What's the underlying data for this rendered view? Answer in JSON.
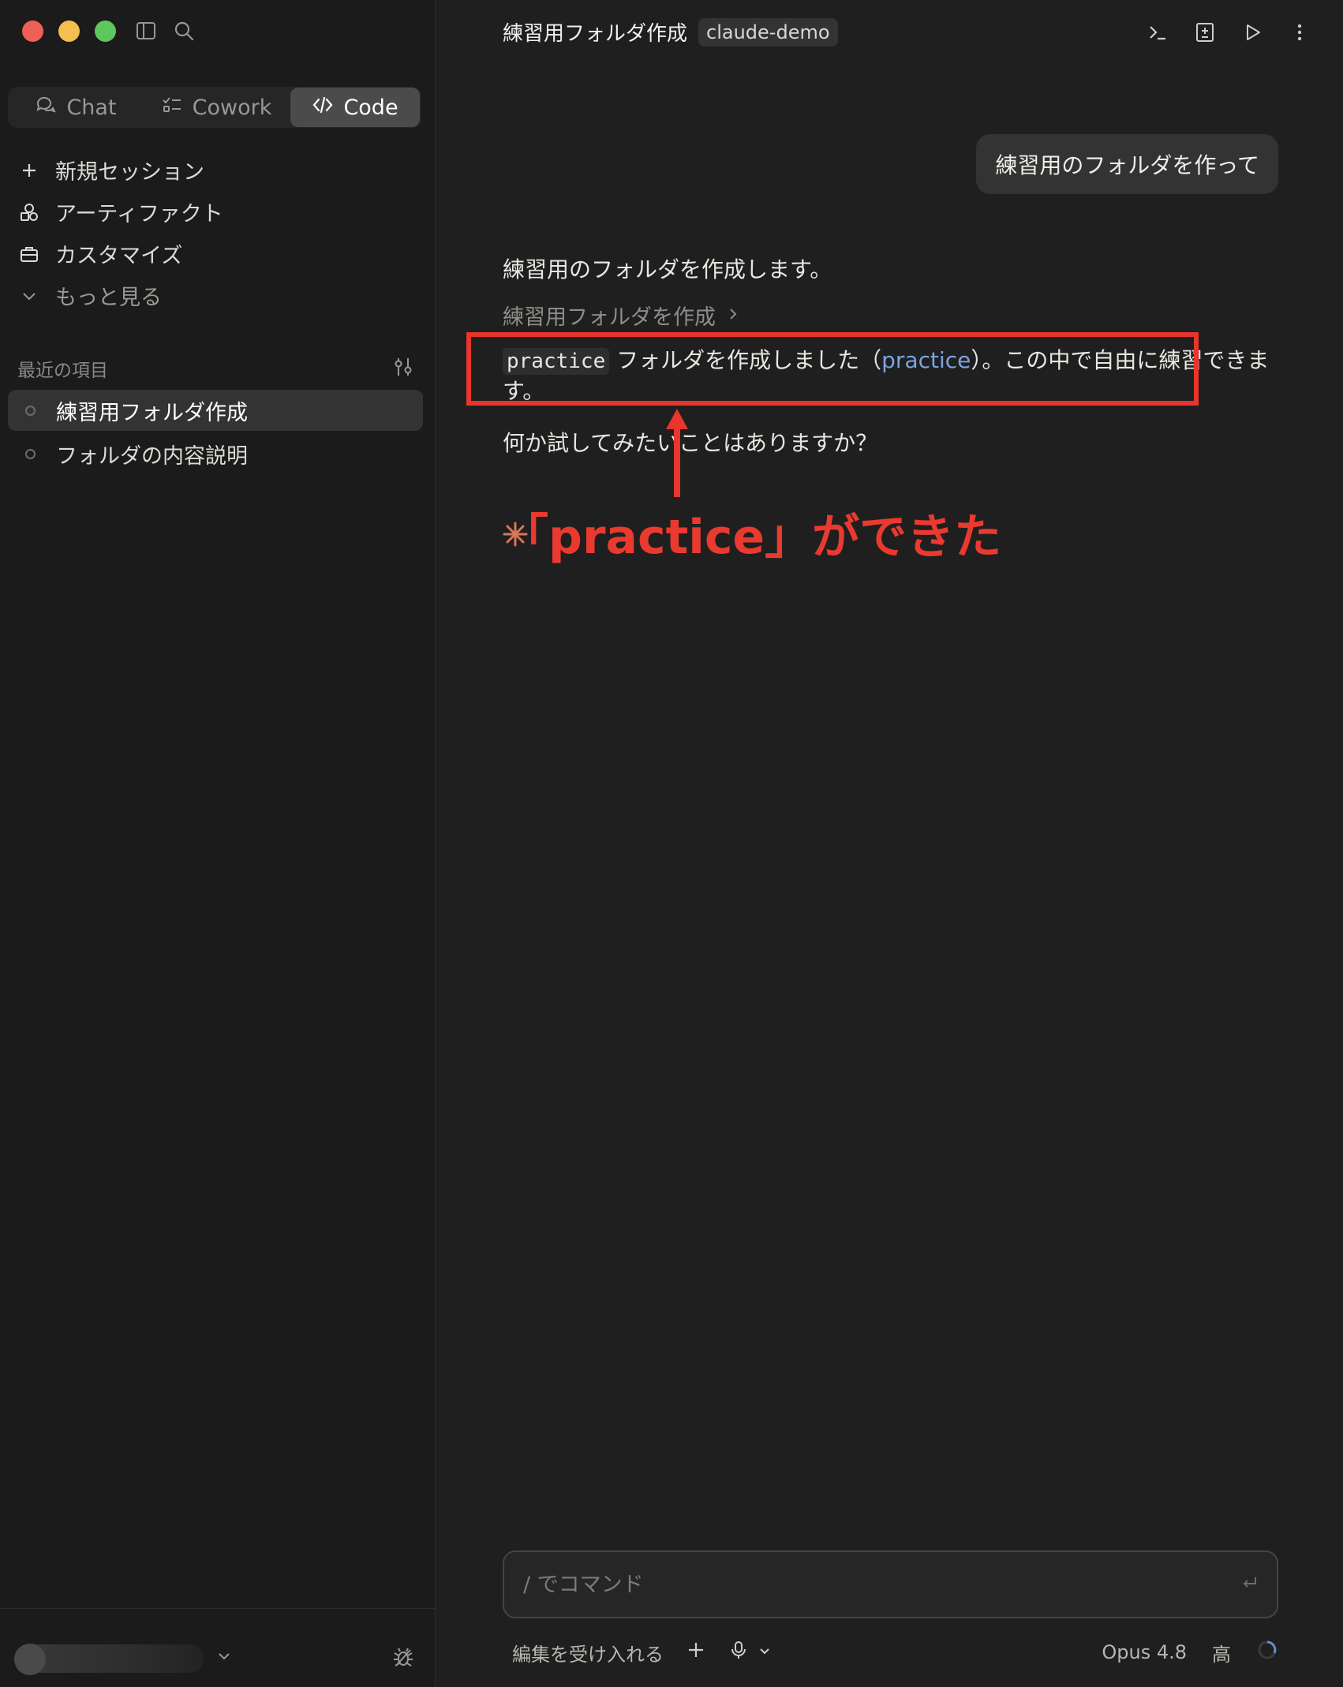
{
  "sidebar": {
    "modes": [
      {
        "label": "Chat",
        "icon": "chat-bubbles-icon"
      },
      {
        "label": "Cowork",
        "icon": "checklist-icon"
      },
      {
        "label": "Code",
        "icon": "code-brackets-icon"
      }
    ],
    "nav": {
      "new_session": "新規セッション",
      "artifacts": "アーティファクト",
      "customize": "カスタマイズ",
      "more": "もっと見る"
    },
    "recent_label": "最近の項目",
    "recent_items": [
      "練習用フォルダ作成",
      "フォルダの内容説明"
    ]
  },
  "header": {
    "title": "練習用フォルダ作成",
    "tag": "claude-demo"
  },
  "conversation": {
    "user_message": "練習用のフォルダを作って",
    "assistant_intro": "練習用のフォルダを作成します。",
    "tool_step": "練習用フォルダを作成",
    "result": {
      "code": "practice",
      "text_before_link": "フォルダを作成しました（",
      "link": "practice",
      "text_after_link": "）。この中で自由に練習できます。"
    },
    "followup": "何か試してみたいことはありますか？"
  },
  "annotation": {
    "text": "「practice」ができた",
    "color": "#e8352e"
  },
  "composer": {
    "placeholder": "/ でコマンド",
    "accept_edits": "編集を受け入れる",
    "model": "Opus 4.8",
    "effort": "高"
  },
  "colors": {
    "background": "#1f1f1f",
    "sidebar": "#1b1b1b",
    "link": "#7ba3e0",
    "annotation": "#e8352e"
  }
}
